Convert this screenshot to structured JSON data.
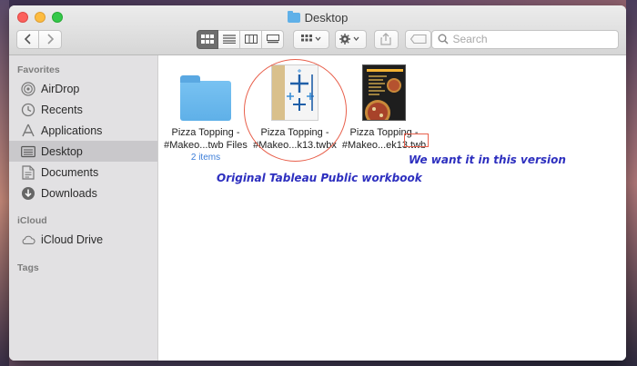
{
  "window": {
    "title": "Desktop"
  },
  "toolbar": {
    "search_placeholder": "Search"
  },
  "sidebar": {
    "sections": [
      {
        "label": "Favorites"
      },
      {
        "label": "iCloud"
      },
      {
        "label": "Tags"
      }
    ],
    "items": [
      {
        "label": "AirDrop",
        "icon": "airdrop-icon"
      },
      {
        "label": "Recents",
        "icon": "clock-icon"
      },
      {
        "label": "Applications",
        "icon": "applications-icon"
      },
      {
        "label": "Desktop",
        "icon": "desktop-icon",
        "selected": true
      },
      {
        "label": "Documents",
        "icon": "document-icon"
      },
      {
        "label": "Downloads",
        "icon": "download-icon"
      },
      {
        "label": "iCloud Drive",
        "icon": "cloud-icon"
      }
    ]
  },
  "files": [
    {
      "line1": "Pizza Topping -",
      "line2": "#Makeo...twb Files",
      "sub": "2 items",
      "icon": "folder-icon"
    },
    {
      "line1": "Pizza Topping -",
      "line2": "#Makeo...k13.twbx",
      "icon": "tableau-workbook-icon"
    },
    {
      "line1": "Pizza Topping -",
      "line2": "#Makeo...ek13.twb",
      "icon": "pizza-document-icon"
    }
  ],
  "annotations": {
    "original": "Original Tableau Public workbook",
    "want": "We want it in this version"
  },
  "colors": {
    "selection": "#c9c8cb",
    "annotation_red": "#e8604c",
    "annotation_text": "#2d2fbf",
    "folder": "#5fb0e8"
  }
}
